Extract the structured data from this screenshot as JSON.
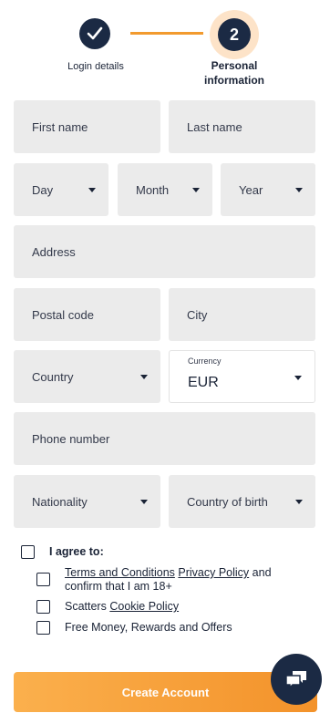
{
  "stepper": {
    "step1_label": "Login details",
    "step2_number": "2",
    "step2_label_line1": "Personal",
    "step2_label_line2": "information"
  },
  "form": {
    "first_name": "First name",
    "last_name": "Last name",
    "day": "Day",
    "month": "Month",
    "year": "Year",
    "address": "Address",
    "postal_code": "Postal code",
    "city": "City",
    "country": "Country",
    "currency_label": "Currency",
    "currency_value": "EUR",
    "phone": "Phone number",
    "nationality": "Nationality",
    "country_of_birth": "Country of birth"
  },
  "consent": {
    "agree": "I agree to:",
    "terms": "Terms and Conditions",
    "privacy": "Privacy Policy",
    "and": "and",
    "confirm": "confirm that I am 18+",
    "scatters": "Scatters",
    "cookie": "Cookie Policy",
    "offers": "Free Money, Rewards and Offers"
  },
  "button": {
    "create": "Create Account"
  },
  "colors": {
    "navy": "#1b2a44",
    "orange": "#f29a2e",
    "field_bg": "#ebebeb"
  },
  "icons": {
    "step1": "check-icon",
    "chat": "chat-bubble-icon"
  }
}
